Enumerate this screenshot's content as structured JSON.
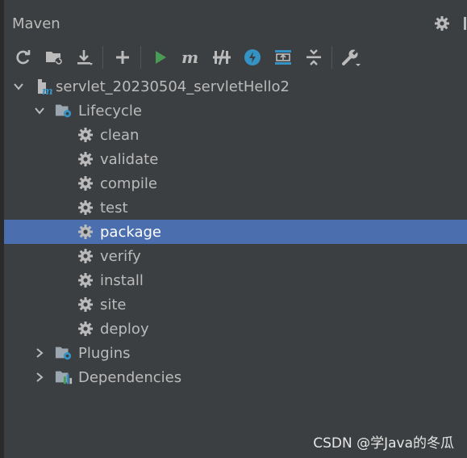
{
  "panel": {
    "title": "Maven"
  },
  "toolbar": {
    "icons": [
      "reload-icon",
      "generate-sources-icon",
      "download-icon",
      "add-icon",
      "run-icon",
      "maven-goal-icon",
      "skip-tests-icon",
      "offline-icon",
      "show-dependencies-icon",
      "collapse-all-icon",
      "settings-wrench-icon"
    ]
  },
  "tree": {
    "project": "servlet_20230504_servletHello2",
    "lifecycle": {
      "label": "Lifecycle",
      "goals": [
        "clean",
        "validate",
        "compile",
        "test",
        "package",
        "verify",
        "install",
        "site",
        "deploy"
      ],
      "selected": "package"
    },
    "plugins": "Plugins",
    "dependencies": "Dependencies"
  },
  "watermark": "CSDN @学Java的冬瓜",
  "colors": {
    "background": "#3c3f41",
    "selection": "#4b6eaf",
    "run_green": "#499c54",
    "icon_blue": "#3592c4",
    "text": "#bbbbbb"
  }
}
